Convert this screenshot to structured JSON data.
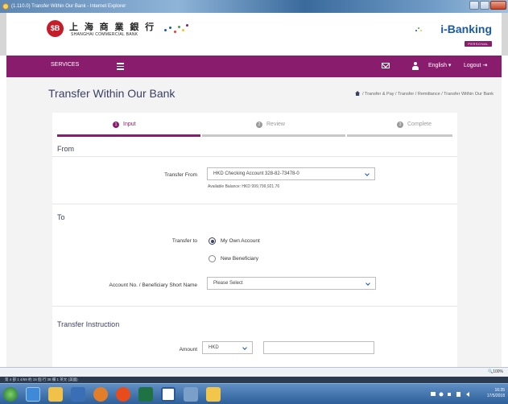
{
  "window": {
    "title": "(1.110.0) Transfer Within Our Bank - Internet Explorer"
  },
  "brand": {
    "name_cn": "上 海 商 業 銀 行",
    "name_en": "SHANGHAI COMMERCIAL BANK",
    "product": "i-Banking",
    "segment": "PERSONAL",
    "colors": {
      "primary": "#8a1c6e",
      "title": "#3a3f63",
      "link": "#1a5aa6",
      "logo": "#c41e2a"
    }
  },
  "nav": {
    "services": "SERVICES",
    "language": "English ▾",
    "logout": "Logout"
  },
  "page": {
    "title": "Transfer Within Our Bank",
    "breadcrumb": "/  Transfer & Pay  /  Transfer / Remittance  /  Transfer Within Our Bank"
  },
  "steps": [
    {
      "num": "1",
      "label": "Input",
      "state": "active"
    },
    {
      "num": "2",
      "label": "Review",
      "state": "inactive"
    },
    {
      "num": "3",
      "label": "Complete",
      "state": "inactive"
    }
  ],
  "from": {
    "section": "From",
    "transfer_from_label": "Transfer From",
    "transfer_from_value": "HKD Checking Account 328-82-73478-0",
    "available_balance": "Available Balance: HKD 999,799,921.76"
  },
  "to": {
    "section": "To",
    "transfer_to_label": "Transfer to",
    "option_own": "My Own Account",
    "option_own_selected": true,
    "option_new": "New Beneficiary",
    "account_label": "Account No. / Beneficiary Short Name",
    "account_value": "Please Select"
  },
  "instruction": {
    "section": "Transfer Instruction",
    "amount_label": "Amount",
    "currency": "HKD",
    "amount_value": ""
  },
  "status": {
    "zoom": "100%",
    "strip": "第 4 部 1      4/69    約 15 個     行 38   欄 1              英文 (美國)",
    "clock_time": "16:35",
    "clock_date": "17/5/2018"
  }
}
